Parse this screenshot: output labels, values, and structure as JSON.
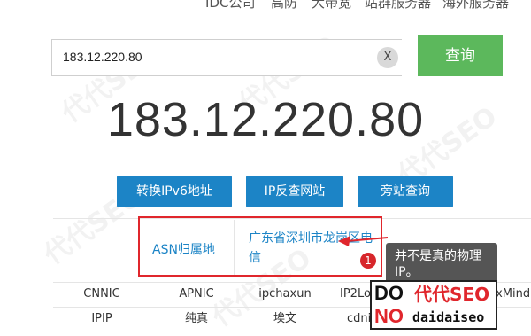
{
  "nav": {
    "items": [
      {
        "label": "IDC公司"
      },
      {
        "label": "高防"
      },
      {
        "label": "大带宽"
      },
      {
        "label": "站群服务器"
      },
      {
        "label": "海外服务器"
      }
    ]
  },
  "search": {
    "value": "183.12.220.80",
    "clear_label": "X",
    "button_label": "查询"
  },
  "result": {
    "ip": "183.12.220.80"
  },
  "actions": [
    {
      "label": "转换IPv6地址"
    },
    {
      "label": "IP反查网站"
    },
    {
      "label": "旁站查询"
    }
  ],
  "asn": {
    "label": "ASN归属地",
    "value": "广东省深圳市龙岗区电信"
  },
  "annotation": {
    "badge": "1",
    "note": "并不是真的物理IP。"
  },
  "sources": {
    "row1": [
      "CNNIC",
      "APNIC",
      "ipchaxun",
      "IP2Location",
      "MaxMind"
    ],
    "row2": [
      "IPIP",
      "纯真",
      "埃文",
      "cdnip"
    ]
  },
  "watermark": {
    "line1": "DO",
    "line2": "NO",
    "brand": "代代SEO",
    "domain": "daidaiseo",
    "background": "代代SEO"
  },
  "colors": {
    "primary": "#1c84c6",
    "query_green": "#5cb85c",
    "highlight_red": "#e0262c",
    "callout_bg": "#555555"
  }
}
